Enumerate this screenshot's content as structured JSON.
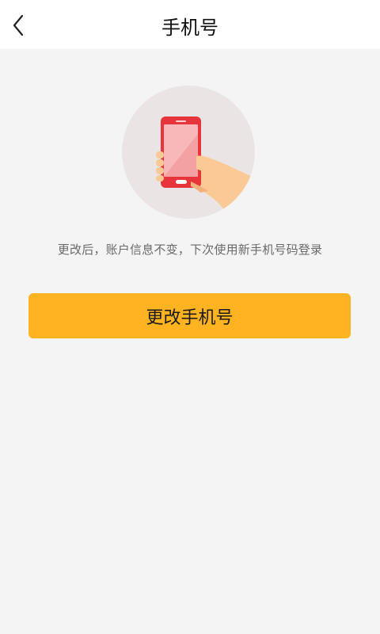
{
  "header": {
    "title": "手机号",
    "back_icon": "chevron-left-icon"
  },
  "illustration": {
    "icon": "hand-holding-phone-illustration",
    "colors": {
      "circle": "#ebe4e4",
      "phone_body": "#e8353b",
      "screen": "#f8b7b8",
      "hand": "#fbc995"
    }
  },
  "hint_text": "更改后，账户信息不变，下次使用新手机号码登录",
  "change_button": {
    "label": "更改手机号",
    "color": "#ffb320"
  }
}
